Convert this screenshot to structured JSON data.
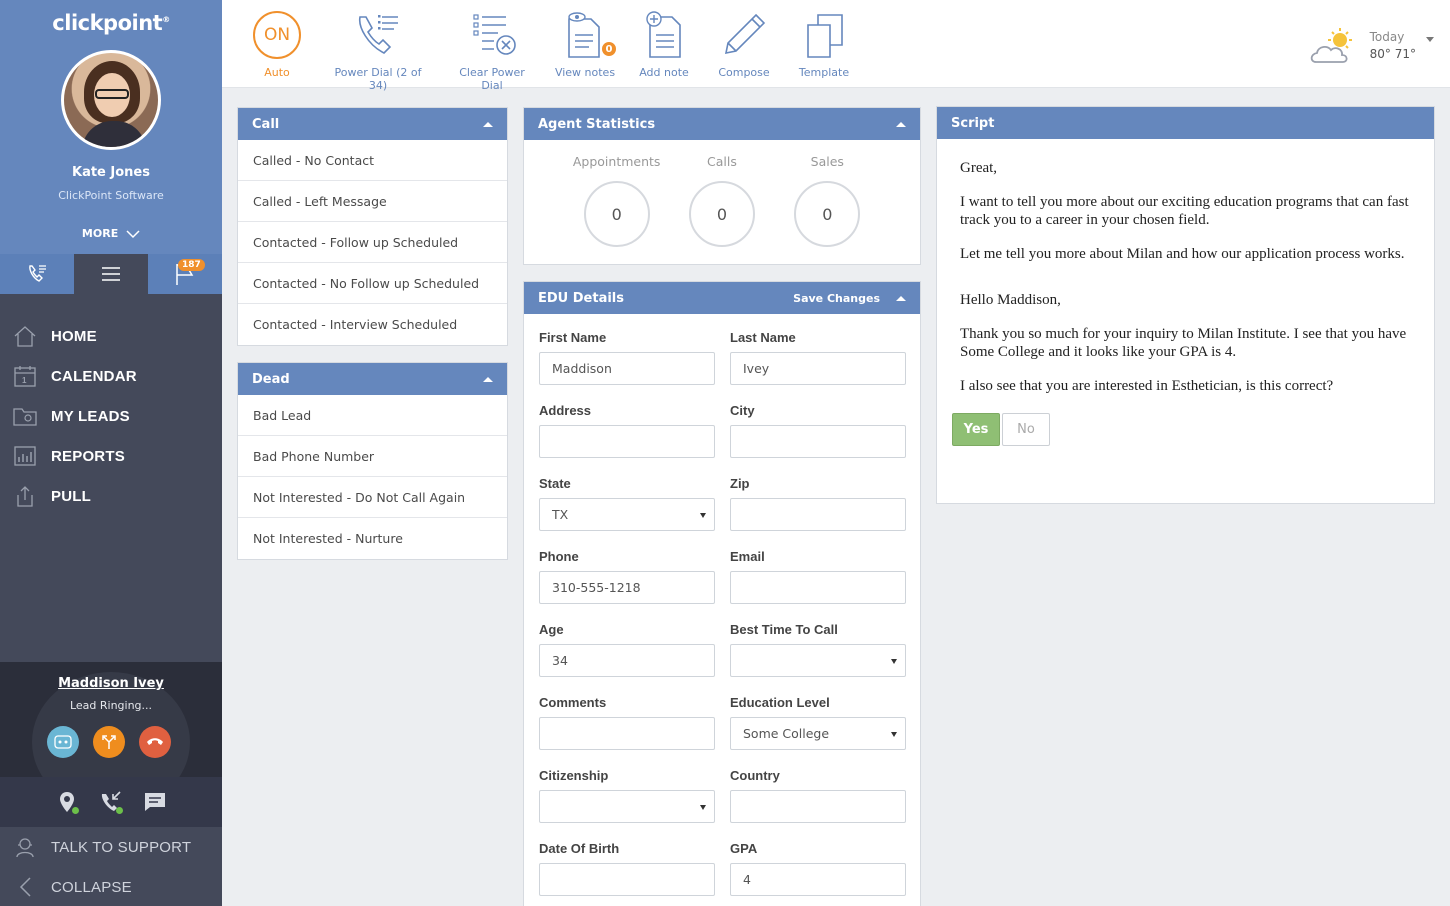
{
  "brand": {
    "logo": "clickpoint",
    "logo_mark": "®"
  },
  "user": {
    "name": "Kate Jones",
    "company": "ClickPoint Software",
    "more_label": "MORE"
  },
  "sidebar_tabs": {
    "flag_badge": "187"
  },
  "nav": [
    {
      "label": "HOME",
      "icon": "home-icon"
    },
    {
      "label": "CALENDAR",
      "icon": "calendar-icon"
    },
    {
      "label": "MY LEADS",
      "icon": "folder-icon"
    },
    {
      "label": "REPORTS",
      "icon": "reports-icon"
    },
    {
      "label": "PULL",
      "icon": "pull-icon"
    }
  ],
  "call": {
    "lead_name": "Maddison Ivey",
    "status": "Lead Ringing..."
  },
  "sidebar_bottom": {
    "support": "TALK TO SUPPORT",
    "collapse": "COLLAPSE"
  },
  "toolbar": {
    "on_label": "ON",
    "auto": "Auto",
    "power_dial": "Power Dial (2 of 34)",
    "clear_power_dial": "Clear Power Dial",
    "view_notes": "View notes",
    "notes_count": "0",
    "add_note": "Add note",
    "compose": "Compose",
    "template": "Template"
  },
  "weather": {
    "day": "Today",
    "temps": "80° 71°"
  },
  "call_panel": {
    "title": "Call",
    "items": [
      "Called - No Contact",
      "Called - Left Message",
      "Contacted - Follow up Scheduled",
      "Contacted - No Follow up Scheduled",
      "Contacted - Interview Scheduled"
    ]
  },
  "dead_panel": {
    "title": "Dead",
    "items": [
      "Bad Lead",
      "Bad Phone Number",
      "Not Interested - Do Not Call Again",
      "Not Interested - Nurture"
    ]
  },
  "agent_stats": {
    "title": "Agent Statistics",
    "stats": [
      {
        "label": "Appointments",
        "value": "0"
      },
      {
        "label": "Calls",
        "value": "0"
      },
      {
        "label": "Sales",
        "value": "0"
      }
    ]
  },
  "edu": {
    "title": "EDU Details",
    "save": "Save Changes",
    "fields": [
      {
        "label": "First Name",
        "value": "Maddison",
        "type": "text"
      },
      {
        "label": "Last Name",
        "value": "Ivey",
        "type": "text"
      },
      {
        "label": "Address",
        "value": "",
        "type": "text"
      },
      {
        "label": "City",
        "value": "",
        "type": "text"
      },
      {
        "label": "State",
        "value": "TX",
        "type": "select"
      },
      {
        "label": "Zip",
        "value": "",
        "type": "text"
      },
      {
        "label": "Phone",
        "value": "310-555-1218",
        "type": "text"
      },
      {
        "label": "Email",
        "value": "",
        "type": "text"
      },
      {
        "label": "Age",
        "value": "34",
        "type": "text"
      },
      {
        "label": "Best Time To Call",
        "value": "",
        "type": "select"
      },
      {
        "label": "Comments",
        "value": "",
        "type": "text"
      },
      {
        "label": "Education Level",
        "value": "Some College",
        "type": "select"
      },
      {
        "label": "Citizenship",
        "value": "",
        "type": "select"
      },
      {
        "label": "Country",
        "value": "",
        "type": "text"
      },
      {
        "label": "Date Of Birth",
        "value": "",
        "type": "text"
      },
      {
        "label": "GPA",
        "value": "4",
        "type": "text"
      }
    ]
  },
  "script": {
    "title": "Script",
    "paragraphs": [
      "Great,",
      "I want to tell you more about our exciting education programs that can fast track you to a career in your chosen field.",
      "Let me tell you more about Milan and how our application process works.",
      "Hello Maddison,",
      "Thank you so much for your inquiry to Milan Institute.  I see that you have Some College and it looks like your GPA is 4.",
      "I also see that you are interested in Esthetician, is this correct?"
    ],
    "yes": "Yes",
    "no": "No"
  },
  "colors": {
    "accent": "#6587bd",
    "orange": "#f0902c",
    "sidebar": "#44495a",
    "yes_green": "#8fbf74"
  }
}
